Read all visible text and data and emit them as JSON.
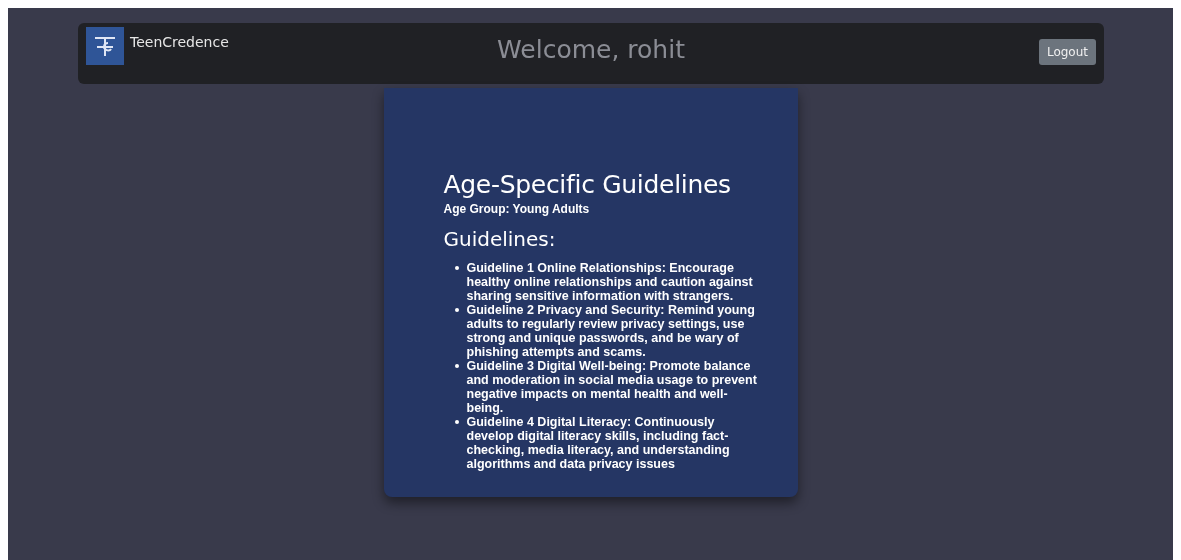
{
  "navbar": {
    "brand": "TeenCredence",
    "welcome": "Welcome, rohit",
    "logout_button": "Logout"
  },
  "card": {
    "title": "Age-Specific Guidelines",
    "age_group": "Age Group: Young Adults",
    "section_title": "Guidelines:",
    "guidelines": [
      "Guideline 1 Online Relationships: Encourage healthy online relationships and caution against sharing sensitive information with strangers.",
      "Guideline 2 Privacy and Security: Remind young adults to regularly review privacy settings, use strong and unique passwords, and be wary of phishing attempts and scams.",
      "Guideline 3 Digital Well-being: Promote balance and moderation in social media usage to prevent negative impacts on mental health and well-being.",
      "Guideline 4 Digital Literacy: Continuously develop digital literacy skills, including fact-checking, media literacy, and understanding algorithms and data privacy issues"
    ]
  }
}
